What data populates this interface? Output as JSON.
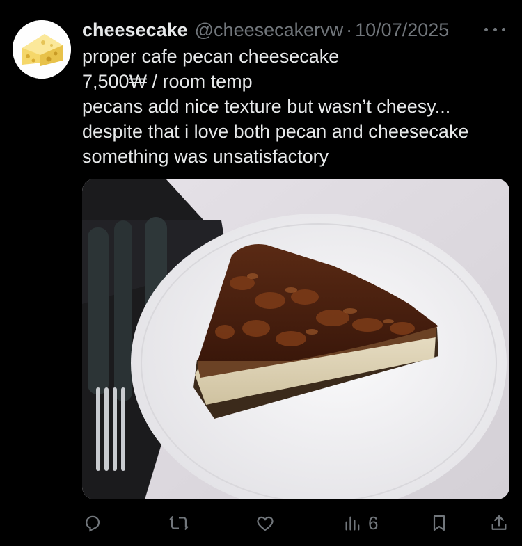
{
  "post": {
    "display_name": "cheesecake",
    "handle": "@cheesecakervw",
    "separator": "·",
    "date": "10/07/2025",
    "lines": [
      "proper cafe pecan cheesecake",
      "7,500₩ / room temp",
      "pecans add nice texture but wasn’t cheesy...",
      "despite that i love both pecan and cheesecake",
      "something was unsatisfactory"
    ]
  },
  "actions": {
    "views_count": "6"
  },
  "icons": {
    "more": "more-horizontal-icon",
    "reply": "reply-icon",
    "repost": "repost-icon",
    "like": "heart-icon",
    "views": "views-icon",
    "bookmark": "bookmark-icon",
    "share": "share-icon"
  },
  "colors": {
    "background": "#000000",
    "text": "#e7e9ea",
    "secondary": "#71767b"
  }
}
